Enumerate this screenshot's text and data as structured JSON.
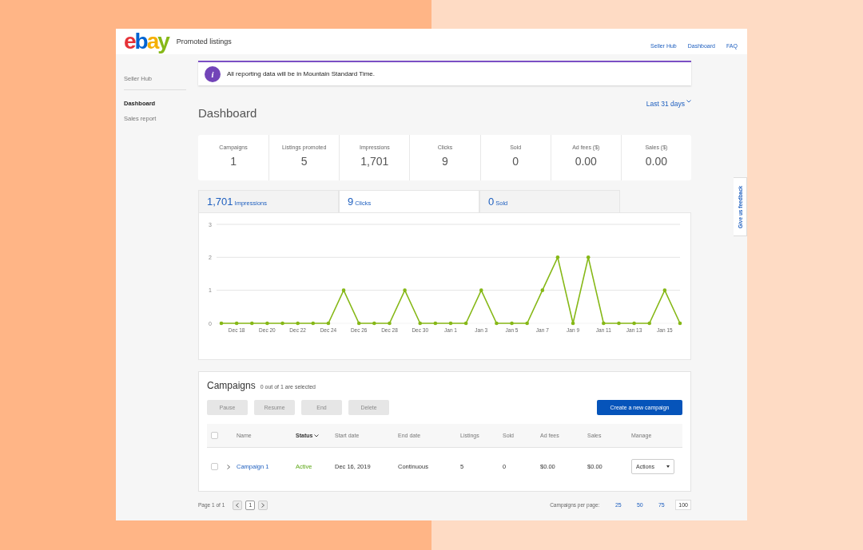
{
  "header": {
    "logo": "ebay",
    "title": "Promoted listings",
    "links": [
      "Seller Hub",
      "Dashboard",
      "FAQ"
    ]
  },
  "sidebar": {
    "items": [
      {
        "label": "Seller Hub",
        "selected": false,
        "divider_after": true
      },
      {
        "label": "Dashboard",
        "selected": true,
        "divider_after": false
      },
      {
        "label": "Sales report",
        "selected": false,
        "divider_after": false
      }
    ]
  },
  "banner": {
    "icon_text": "i",
    "message": "All reporting data will be in Mountain Standard Time."
  },
  "page_title": "Dashboard",
  "period": "Last 31 days",
  "stats": [
    {
      "label": "Campaigns",
      "value": "1"
    },
    {
      "label": "Listings promoted",
      "value": "5"
    },
    {
      "label": "Impressions",
      "value": "1,701"
    },
    {
      "label": "Clicks",
      "value": "9"
    },
    {
      "label": "Sold",
      "value": "0"
    },
    {
      "label": "Ad fees ($)",
      "value": "0.00"
    },
    {
      "label": "Sales ($)",
      "value": "0.00"
    }
  ],
  "metric_tabs": [
    {
      "value": "1,701",
      "label": "Impressions",
      "selected": false
    },
    {
      "value": "9",
      "label": "Clicks",
      "selected": true
    },
    {
      "value": "0",
      "label": "Sold",
      "selected": false
    }
  ],
  "chart_data": {
    "type": "line",
    "categories": [
      null,
      "Dec 18",
      null,
      "Dec 20",
      null,
      "Dec 22",
      null,
      "Dec 24",
      null,
      "Dec 26",
      null,
      "Dec 28",
      null,
      "Dec 30",
      null,
      "Jan 1",
      null,
      "Jan 3",
      null,
      "Jan 5",
      null,
      "Jan 7",
      null,
      "Jan 9",
      null,
      "Jan 11",
      null,
      "Jan 13",
      null,
      "Jan 15",
      null
    ],
    "series": [
      {
        "color": "#86b817",
        "values": [
          0,
          0,
          0,
          0,
          0,
          0,
          0,
          0,
          1,
          0,
          0,
          0,
          1,
          0,
          0,
          0,
          0,
          1,
          0,
          0,
          0,
          1,
          2,
          0,
          2,
          0,
          0,
          0,
          0,
          1,
          0
        ]
      }
    ],
    "ylim": [
      0,
      3
    ],
    "yticks": [
      0,
      1,
      2,
      3
    ]
  },
  "campaigns": {
    "title": "Campaigns",
    "selection_note": "0 out of 1 are selected",
    "actions": [
      {
        "label": "Pause",
        "disabled": true
      },
      {
        "label": "Resume",
        "disabled": true
      },
      {
        "label": "End",
        "disabled": true
      },
      {
        "label": "Delete",
        "disabled": true
      }
    ],
    "create_button": "Create a new campaign",
    "select_all_checked": false,
    "columns": [
      {
        "label": "Name",
        "sorted": false
      },
      {
        "label": "Status",
        "sorted": true
      },
      {
        "label": "Start date",
        "sorted": false
      },
      {
        "label": "End date",
        "sorted": false
      },
      {
        "label": "Listings",
        "sorted": false
      },
      {
        "label": "Sold",
        "sorted": false
      },
      {
        "label": "Ad fees",
        "sorted": false
      },
      {
        "label": "Sales",
        "sorted": false
      },
      {
        "label": "Manage",
        "sorted": false
      }
    ],
    "rows": [
      {
        "checked": false,
        "expanded": false,
        "name": "Campaign 1",
        "status": "Active",
        "start_date": "Dec 16, 2019",
        "end_date": "Continuous",
        "listings": "5",
        "sold": "0",
        "ad_fees": "$0.00",
        "sales": "$0.00",
        "manage": "Actions"
      }
    ]
  },
  "pagination": {
    "page_label": "Page 1 of 1",
    "pages": [
      {
        "label": "1",
        "selected": true
      }
    ],
    "per_page_label": "Campaigns per page:",
    "per_page_options": [
      {
        "label": "25",
        "selected": false
      },
      {
        "label": "50",
        "selected": false
      },
      {
        "label": "75",
        "selected": false
      },
      {
        "label": "100",
        "selected": true
      }
    ]
  },
  "feedback_tab": "Give us feedback"
}
